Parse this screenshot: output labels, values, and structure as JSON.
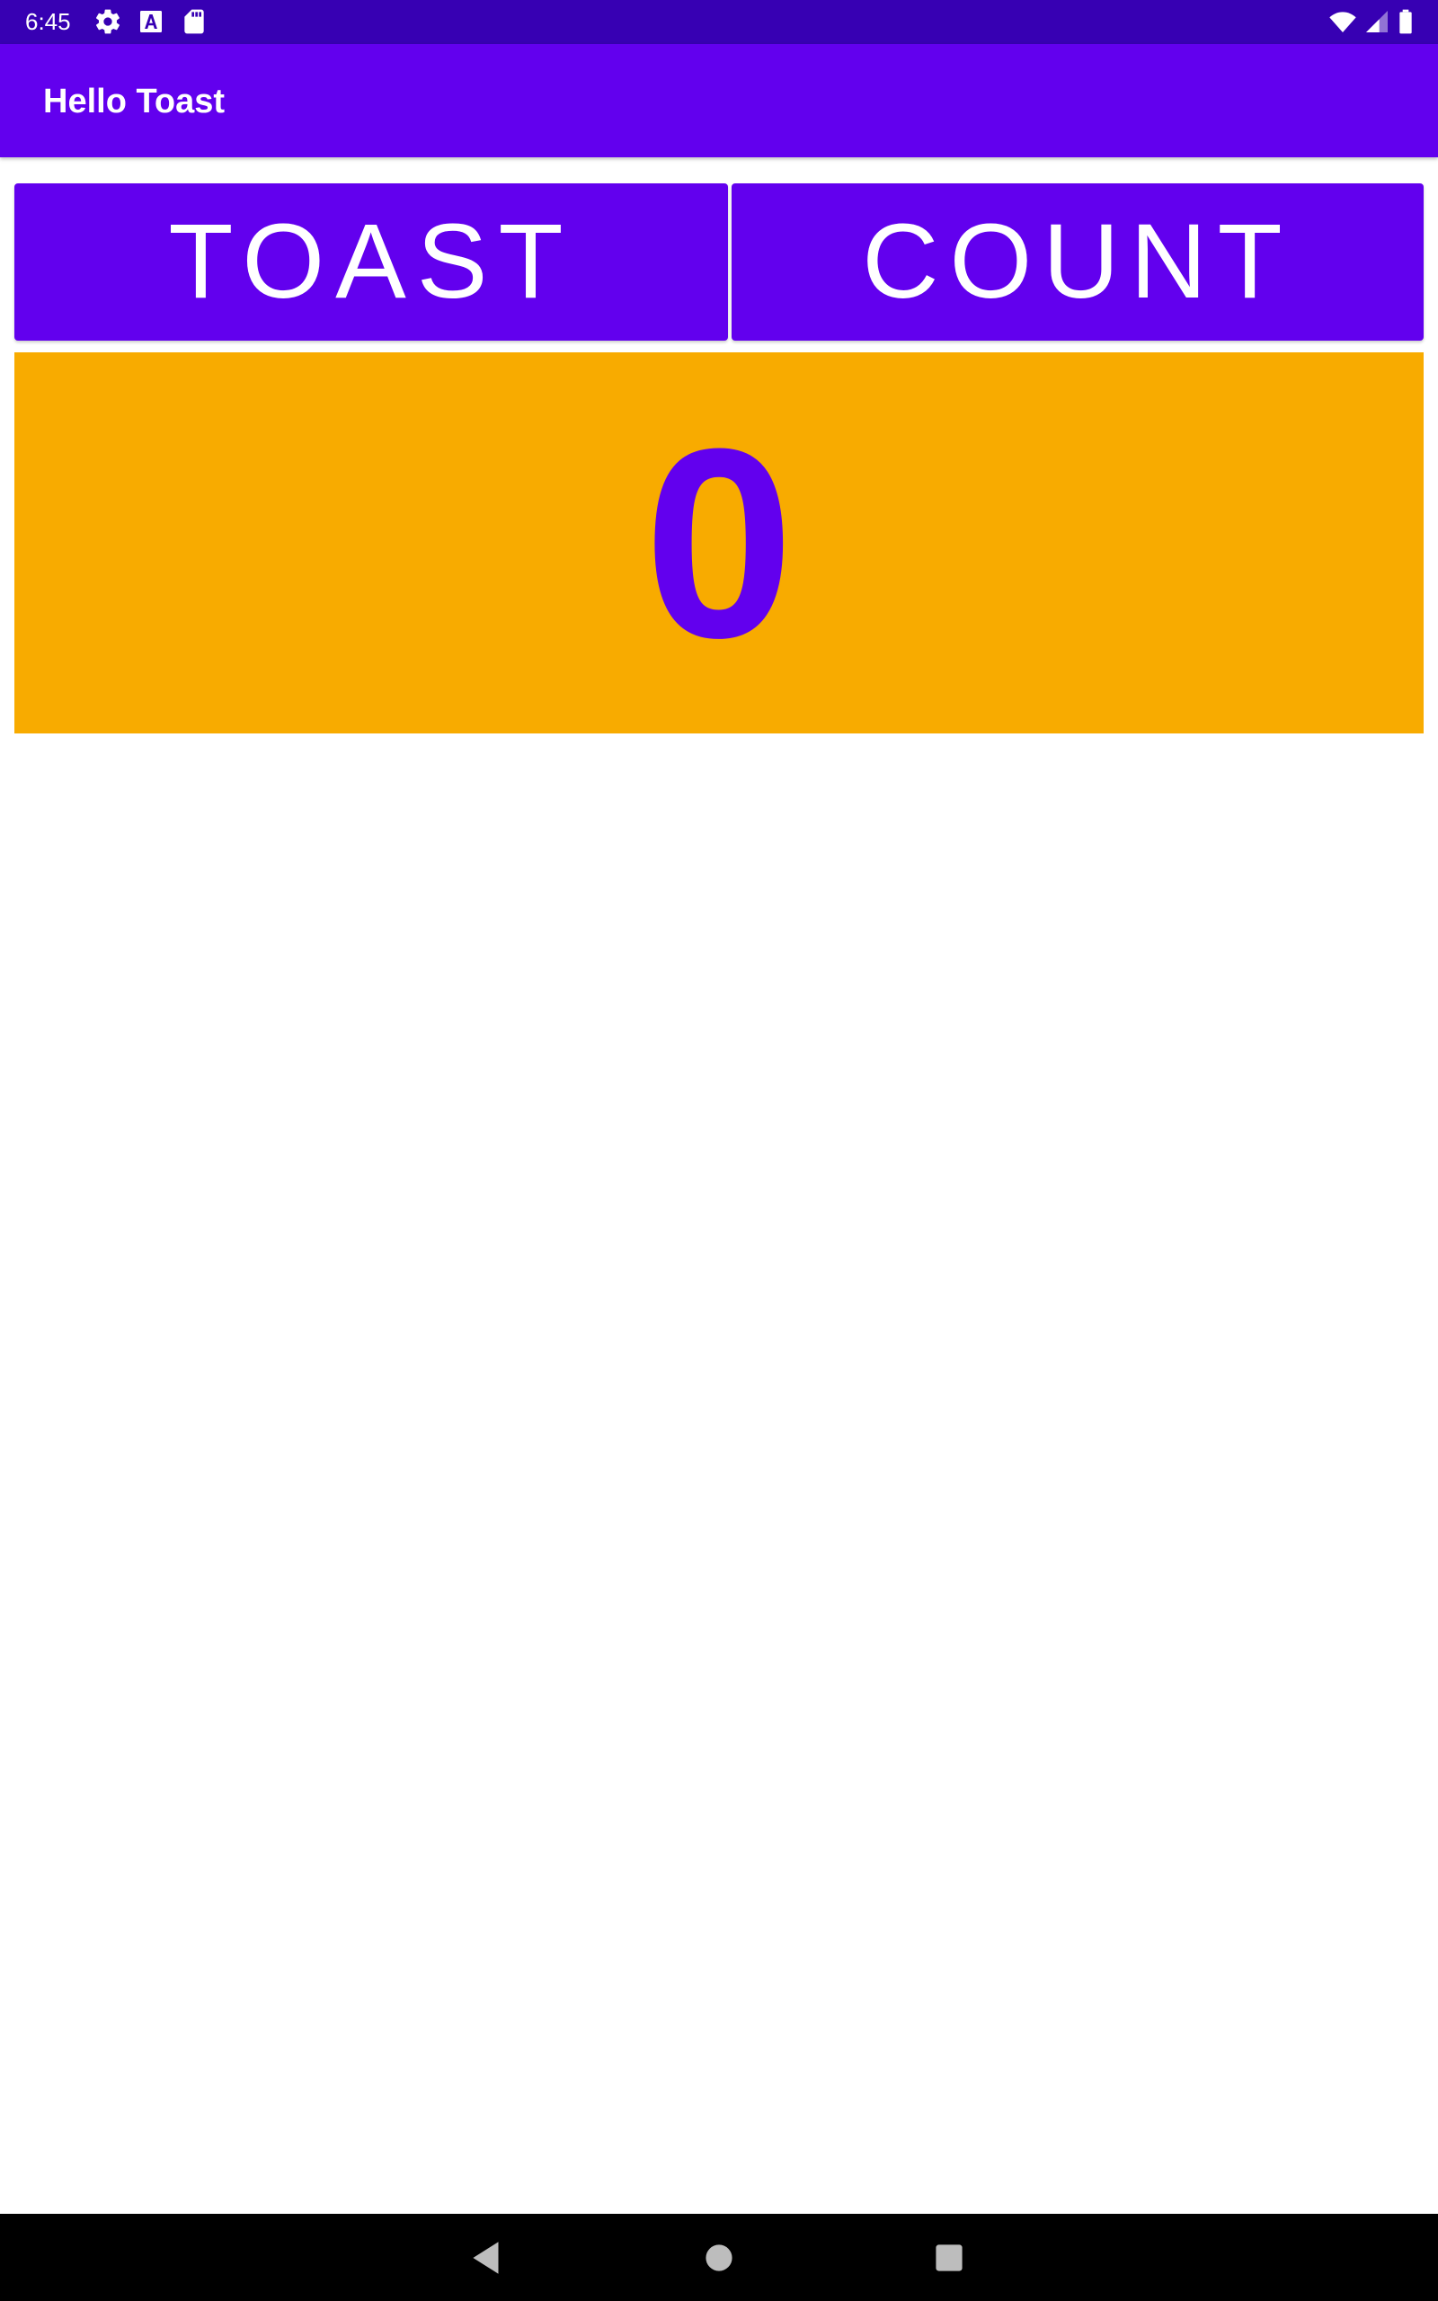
{
  "status_bar": {
    "time": "6:45",
    "icons": [
      "gear-icon",
      "font-a-icon",
      "sd-card-icon",
      "wifi-icon",
      "signal-icon",
      "battery-icon"
    ],
    "background_color": "#3700b3"
  },
  "app_bar": {
    "title": "Hello Toast",
    "background_color": "#6200ee"
  },
  "buttons": {
    "toast_label": "TOAST",
    "count_label": "COUNT",
    "background_color": "#6200ee"
  },
  "counter": {
    "value": "0",
    "background_color": "#f8ab00",
    "text_color": "#6200ee"
  },
  "nav_bar": {
    "icons": [
      "back-icon",
      "home-icon",
      "recents-icon"
    ]
  }
}
